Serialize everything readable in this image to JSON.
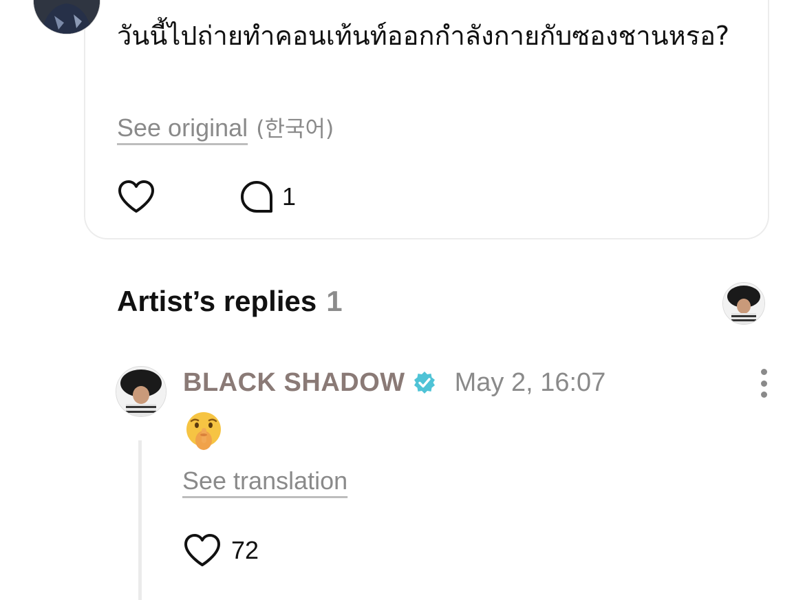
{
  "post": {
    "text": "วันนี้ไปถ่ายทำคอนเท้นท์ออกกำลังกายกับซองชานหรอ?",
    "see_original_label": "See original",
    "original_language": "(한국어)",
    "comment_count": "1"
  },
  "replies_section": {
    "title": "Artist’s replies",
    "count": "1"
  },
  "reply": {
    "author": "BLACK SHADOW",
    "timestamp": "May 2, 16:07",
    "emoji": "🤫",
    "see_translation_label": "See translation",
    "like_count": "72"
  },
  "colors": {
    "verified_badge": "#4fc3d6",
    "author_name": "#8a7a76",
    "muted_text": "#8a8a8a"
  },
  "icons": [
    "heart-icon",
    "comment-icon",
    "verified-badge-icon",
    "more-options-icon"
  ]
}
